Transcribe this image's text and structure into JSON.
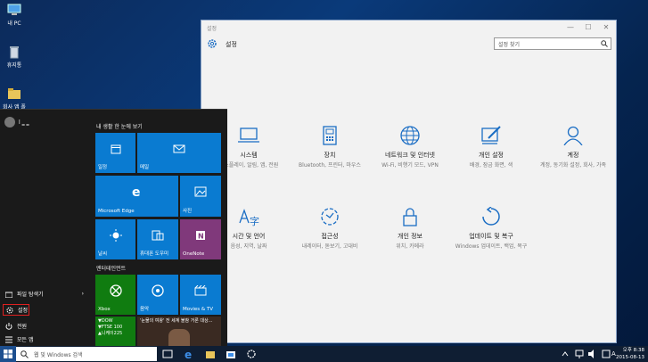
{
  "desktop": {
    "icons": [
      {
        "label": "내 PC"
      },
      {
        "label": "휴지통"
      },
      {
        "label": "회사 앱 폴더"
      }
    ]
  },
  "settings": {
    "window_title": "설정",
    "header_title": "설정",
    "search_placeholder": "설정 찾기",
    "window_controls": {
      "minimize": "—",
      "maximize": "☐",
      "close": "✕"
    },
    "categories": [
      {
        "title": "시스템",
        "desc": "디스플레이, 알림, 앱, 전원",
        "icon": "laptop-icon"
      },
      {
        "title": "장치",
        "desc": "Bluetooth, 프린터, 마우스",
        "icon": "keyboard-device-icon"
      },
      {
        "title": "네트워크 및 인터넷",
        "desc": "Wi-Fi, 비행기 모드, VPN",
        "icon": "globe-icon"
      },
      {
        "title": "개인 설정",
        "desc": "배경, 잠금 화면, 색",
        "icon": "paint-icon"
      },
      {
        "title": "계정",
        "desc": "계정, 동기화 설정, 회사, 가족",
        "icon": "person-icon"
      },
      {
        "title": "시간 및 언어",
        "desc": "음성, 지역, 날짜",
        "icon": "time-language-icon"
      },
      {
        "title": "접근성",
        "desc": "내레이터, 돋보기, 고대비",
        "icon": "ease-of-access-icon"
      },
      {
        "title": "개인 정보",
        "desc": "위치, 카메라",
        "icon": "lock-icon"
      },
      {
        "title": "업데이트 및 복구",
        "desc": "Windows 업데이트, 백업, 복구",
        "icon": "refresh-icon"
      }
    ]
  },
  "start": {
    "user_name": "l ‗ ‗",
    "left_items": [
      {
        "label": "파일 탐색기",
        "chevron": "›"
      },
      {
        "label": "설정"
      },
      {
        "label": "전원"
      },
      {
        "label": "모든 앱"
      }
    ],
    "group1": "내 생활 한 눈에 보기",
    "group2": "엔터테인먼트",
    "tiles": {
      "calendar": "일정",
      "mail": "메일",
      "edge": "Microsoft Edge",
      "photos": "사진",
      "weather": "날씨",
      "phone": "휴대폰 도우미",
      "onenote": "OneNote",
      "xbox": "Xbox",
      "groove": "음악",
      "movies": "Movies & TV",
      "stocks": [
        "▼DOW",
        "▼FTSE 100",
        "▲니케이225"
      ],
      "news": "'눈물의 여왕' 전 세계 불참 거론 대상..."
    }
  },
  "taskbar": {
    "search_placeholder": "웹 및 Windows 검색",
    "time": "오후 8:38",
    "date": "2015-08-13",
    "ime": "A"
  },
  "colors": {
    "tile_blue": "#0a7bd1",
    "green": "#107c10",
    "purple": "#80397b",
    "settings_accent": "#1a6dc4"
  }
}
